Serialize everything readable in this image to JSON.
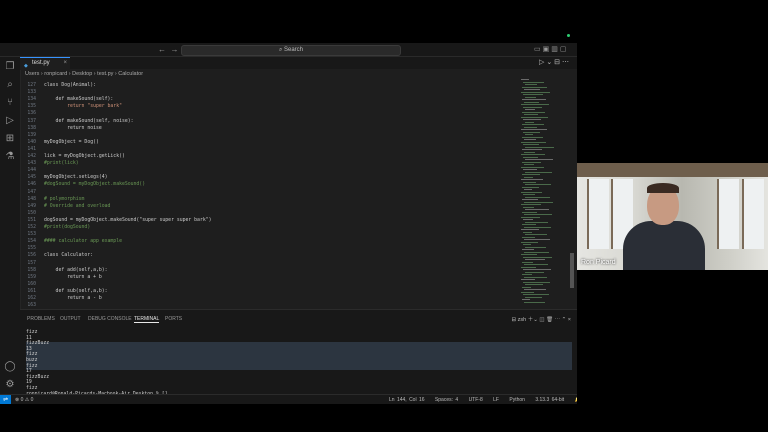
{
  "title_bar": {
    "search_label": "Search",
    "back": "←",
    "forward": "→"
  },
  "tab": {
    "filename": "test.py"
  },
  "breadcrumb": [
    "Users",
    "ronpicard",
    "Desktop",
    "test.py",
    "Calculator"
  ],
  "code_lines": [
    {
      "n": "127",
      "t": "class Dog(Animal):",
      "c": "#cccccc"
    },
    {
      "n": "133",
      "t": "",
      "c": "#cccccc"
    },
    {
      "n": "134",
      "t": "    def makeSound(self):",
      "c": "#cccccc"
    },
    {
      "n": "135",
      "t": "        return \"super bark\"",
      "c": "#ce9178"
    },
    {
      "n": "136",
      "t": "",
      "c": "#cccccc"
    },
    {
      "n": "137",
      "t": "    def makeSound(self, noise):",
      "c": "#cccccc"
    },
    {
      "n": "138",
      "t": "        return noise",
      "c": "#cccccc"
    },
    {
      "n": "139",
      "t": "",
      "c": "#cccccc"
    },
    {
      "n": "140",
      "t": "myDogObject = Dog()",
      "c": "#cccccc"
    },
    {
      "n": "141",
      "t": "",
      "c": "#cccccc"
    },
    {
      "n": "142",
      "t": "lick = myDogObject.getLick()",
      "c": "#cccccc"
    },
    {
      "n": "143",
      "t": "#print(lick)",
      "c": "#6a9955"
    },
    {
      "n": "144",
      "t": "",
      "c": "#cccccc"
    },
    {
      "n": "145",
      "t": "myDogObject.setLegs(4)",
      "c": "#cccccc"
    },
    {
      "n": "146",
      "t": "#dogSound = myDogObject.makeSound()",
      "c": "#6a9955"
    },
    {
      "n": "147",
      "t": "",
      "c": "#cccccc"
    },
    {
      "n": "148",
      "t": "# polymorphism",
      "c": "#6a9955"
    },
    {
      "n": "149",
      "t": "# Override and overload",
      "c": "#6a9955"
    },
    {
      "n": "150",
      "t": "",
      "c": "#cccccc"
    },
    {
      "n": "151",
      "t": "dogSound = myDogObject.makeSound(\"super super super bark\")",
      "c": "#cccccc"
    },
    {
      "n": "152",
      "t": "#print(dogSound)",
      "c": "#6a9955"
    },
    {
      "n": "153",
      "t": "",
      "c": "#cccccc"
    },
    {
      "n": "154",
      "t": "#### calculator app example",
      "c": "#6a9955"
    },
    {
      "n": "155",
      "t": "",
      "c": "#cccccc"
    },
    {
      "n": "156",
      "t": "class Calculator:",
      "c": "#cccccc"
    },
    {
      "n": "157",
      "t": "",
      "c": "#cccccc"
    },
    {
      "n": "158",
      "t": "    def add(self,a,b):",
      "c": "#cccccc"
    },
    {
      "n": "159",
      "t": "        return a + b",
      "c": "#cccccc"
    },
    {
      "n": "160",
      "t": "",
      "c": "#cccccc"
    },
    {
      "n": "161",
      "t": "    def sub(self,a,b):",
      "c": "#cccccc"
    },
    {
      "n": "162",
      "t": "        return a - b",
      "c": "#cccccc"
    },
    {
      "n": "163",
      "t": "",
      "c": "#cccccc"
    }
  ],
  "panel_tabs": [
    "PROBLEMS",
    "OUTPUT",
    "DEBUG CONSOLE",
    "TERMINAL",
    "PORTS"
  ],
  "panel_shell": "zsh",
  "terminal_lines": [
    "fizz",
    "11",
    "fizzBuzz",
    "13",
    "fizz",
    "buzz",
    "fizz",
    "17",
    "fizzBuzz",
    "19",
    "fizz",
    "ronpicard@Ronald-Picards-Macbook-Air Desktop % []"
  ],
  "status_bar": {
    "problems": "⊗ 0  ⚠ 0",
    "position": "Ln 144, Col 16",
    "spaces": "Spaces: 4",
    "encoding": "UTF-8",
    "eol": "LF",
    "language": "Python",
    "interpreter": "3.13.3 64-bit"
  },
  "video": {
    "participant_name": "Ron Picard"
  }
}
